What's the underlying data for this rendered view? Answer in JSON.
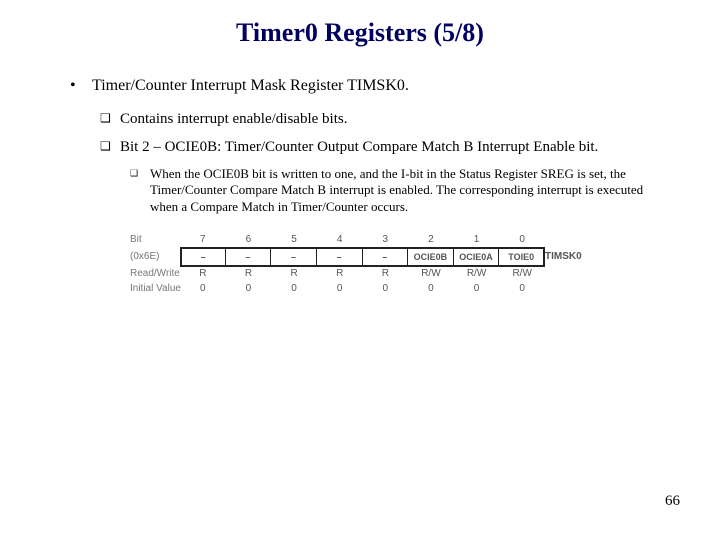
{
  "title": "Timer0 Registers (5/8)",
  "bullets": {
    "lvl1_0": "Timer/Counter Interrupt Mask Register TIMSK0.",
    "lvl2_0": "Contains interrupt enable/disable bits.",
    "lvl2_1": "Bit 2 – OCIE0B: Timer/Counter Output Compare Match B Interrupt Enable bit.",
    "lvl3_0": "When the OCIE0B bit is written to one, and the I-bit in the Status Register SREG is set, the Timer/Counter Compare Match B interrupt is enabled. The corresponding interrupt is executed when a Compare Match in Timer/Counter occurs."
  },
  "register": {
    "row_labels": {
      "bit": "Bit",
      "addr": "(0x6E)",
      "rw": "Read/Write",
      "init": "Initial Value"
    },
    "bit_numbers": [
      "7",
      "6",
      "5",
      "4",
      "3",
      "2",
      "1",
      "0"
    ],
    "bit_names": [
      "–",
      "–",
      "–",
      "–",
      "–",
      "OCIE0B",
      "OCIE0A",
      "TOIE0"
    ],
    "rw": [
      "R",
      "R",
      "R",
      "R",
      "R",
      "R/W",
      "R/W",
      "R/W"
    ],
    "init": [
      "0",
      "0",
      "0",
      "0",
      "0",
      "0",
      "0",
      "0"
    ],
    "reg_name": "TIMSK0"
  },
  "page_number": "66"
}
